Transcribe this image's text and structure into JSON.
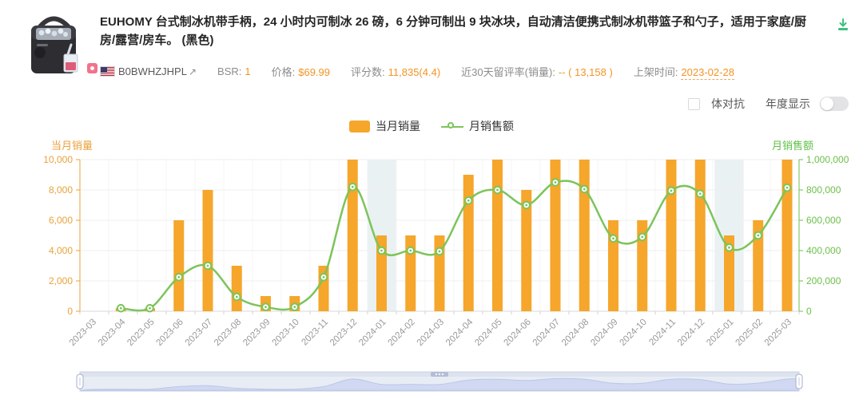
{
  "header": {
    "title": "EUHOMY 台式制冰机带手柄，24 小时内可制冰 26 磅，6 分钟可制出 9 块冰块，自动清洁便携式制冰机带篮子和勺子，适用于家庭/厨房/露营/房车。 (黑色)",
    "asin": "B0BWHZJHPL",
    "external_link_icon": "↗",
    "marketplace_flag": "us-flag",
    "stats": [
      {
        "label": "BSR:",
        "value": "1"
      },
      {
        "label": "价格:",
        "value": "$69.99"
      },
      {
        "label": "评分数:",
        "value": "11,835(4.4)"
      },
      {
        "label": "近30天留评率(销量):",
        "value": "-- ( 13,158 )"
      },
      {
        "label": "上架时间:",
        "value": "2023-02-28"
      }
    ]
  },
  "controls": {
    "variant_checkbox_label": "体对抗",
    "variant_checkbox_checked": false,
    "year_toggle_label": "年度显示",
    "year_toggle_on": false
  },
  "legend": {
    "bar_label": "当月销量",
    "line_label": "月销售额"
  },
  "colors": {
    "bar_orange": "#F5A62B",
    "line_green": "#7CC45B",
    "left_axis_orange": "#E9A23B",
    "right_axis_green": "#6CC04A",
    "value_orange": "#F39423",
    "download_green": "#3FBF7F",
    "highlight_band": "#EAF1F3",
    "brush_fill": "#CDD5F2"
  },
  "chart_data": {
    "type": "bar",
    "title": "",
    "categories": [
      "2023-03",
      "2023-04",
      "2023-05",
      "2023-06",
      "2023-07",
      "2023-08",
      "2023-09",
      "2023-10",
      "2023-11",
      "2023-12",
      "2024-01",
      "2024-02",
      "2024-03",
      "2024-04",
      "2024-05",
      "2024-06",
      "2024-07",
      "2024-08",
      "2024-09",
      "2024-10",
      "2024-11",
      "2024-12",
      "2025-01",
      "2025-02",
      "2025-03"
    ],
    "series": [
      {
        "name": "当月销量",
        "type": "bar",
        "axis": "left",
        "color": "#F5A62B",
        "values": [
          null,
          200,
          200,
          6000,
          8000,
          3000,
          1000,
          1000,
          3000,
          10000,
          5000,
          5000,
          5000,
          9000,
          10000,
          8000,
          10000,
          10000,
          6000,
          6000,
          10000,
          10000,
          5000,
          6000,
          10000
        ]
      },
      {
        "name": "月销售额",
        "type": "line",
        "axis": "right",
        "color": "#7CC45B",
        "values": [
          null,
          20000,
          20000,
          225000,
          300000,
          95000,
          28000,
          28000,
          225000,
          820000,
          400000,
          400000,
          395000,
          730000,
          800000,
          700000,
          850000,
          805000,
          480000,
          490000,
          795000,
          775000,
          420000,
          500000,
          815000
        ]
      }
    ],
    "left_axis": {
      "name": "当月销量",
      "min": 0,
      "max": 10000,
      "ticks": [
        "10,000",
        "8,000",
        "6,000",
        "4,000",
        "2,000",
        "0"
      ],
      "color": "#E9A23B"
    },
    "right_axis": {
      "name": "月销售额",
      "min": 0,
      "max": 1000000,
      "ticks": [
        "1,000,000",
        "800,000",
        "600,000",
        "400,000",
        "200,000",
        "0"
      ],
      "color": "#6CC04A"
    },
    "highlight_categories": [
      "2024-01",
      "2025-01"
    ],
    "legend_position": "top-center",
    "grid": true,
    "has_datazoom_brush": true
  }
}
